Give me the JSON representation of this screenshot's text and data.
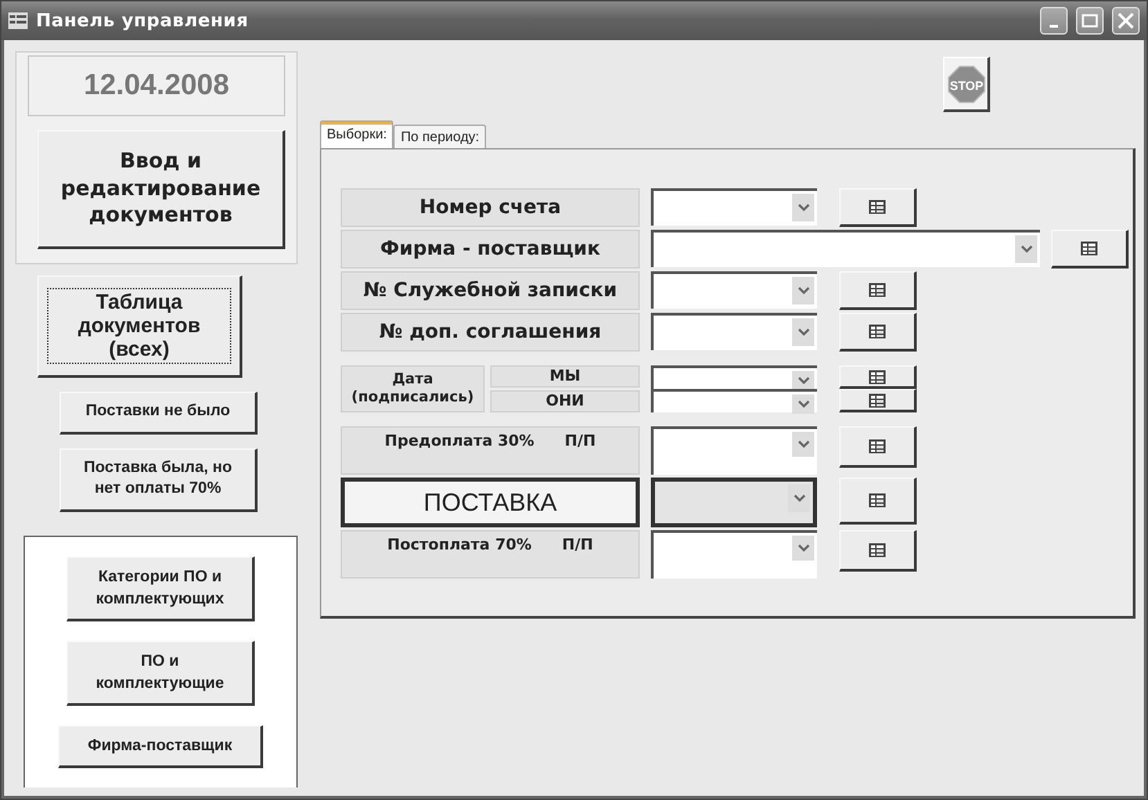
{
  "window": {
    "title": "Панель управления"
  },
  "date": "12.04.2008",
  "main_button": {
    "label": "Ввод и редактирование документов"
  },
  "left_buttons": [
    {
      "label": "Таблица документов (всех)",
      "kind": "large",
      "focused": true
    },
    {
      "label": "Поставки не было",
      "kind": "small",
      "focused": false
    },
    {
      "label": "Поставка была, но нет оплаты 70%",
      "kind": "small",
      "focused": false
    }
  ],
  "reference_buttons": [
    {
      "label": "Категории ПО и комплектующих",
      "kind": "narrow"
    },
    {
      "label": "ПО и комплектующие",
      "kind": "narrow"
    },
    {
      "label": "Фирма-поставщик",
      "kind": "wide"
    }
  ],
  "stop_button": {
    "label": "STOP"
  },
  "tabs": [
    {
      "label": "Выборки:",
      "selected": true
    },
    {
      "label": "По периоду:",
      "selected": false
    }
  ],
  "groups": [
    [
      {
        "kind": "field",
        "label": "Номер счета"
      },
      {
        "kind": "wide-field",
        "label": "Фирма - поставщик"
      },
      {
        "kind": "field",
        "label": "№ Служебной записки"
      },
      {
        "kind": "field",
        "label": "№ доп. соглашения"
      }
    ],
    [
      {
        "kind": "pair",
        "label": "Дата (подписались)",
        "parts": [
          "МЫ",
          "ОНИ"
        ]
      }
    ],
    [
      {
        "kind": "payment",
        "label": "Предоплата 30%",
        "suffix": "П/П"
      },
      {
        "kind": "emphasis",
        "label": "ПОСТАВКА"
      },
      {
        "kind": "payment",
        "label": "Постоплата 70%",
        "suffix": "П/П"
      }
    ]
  ]
}
